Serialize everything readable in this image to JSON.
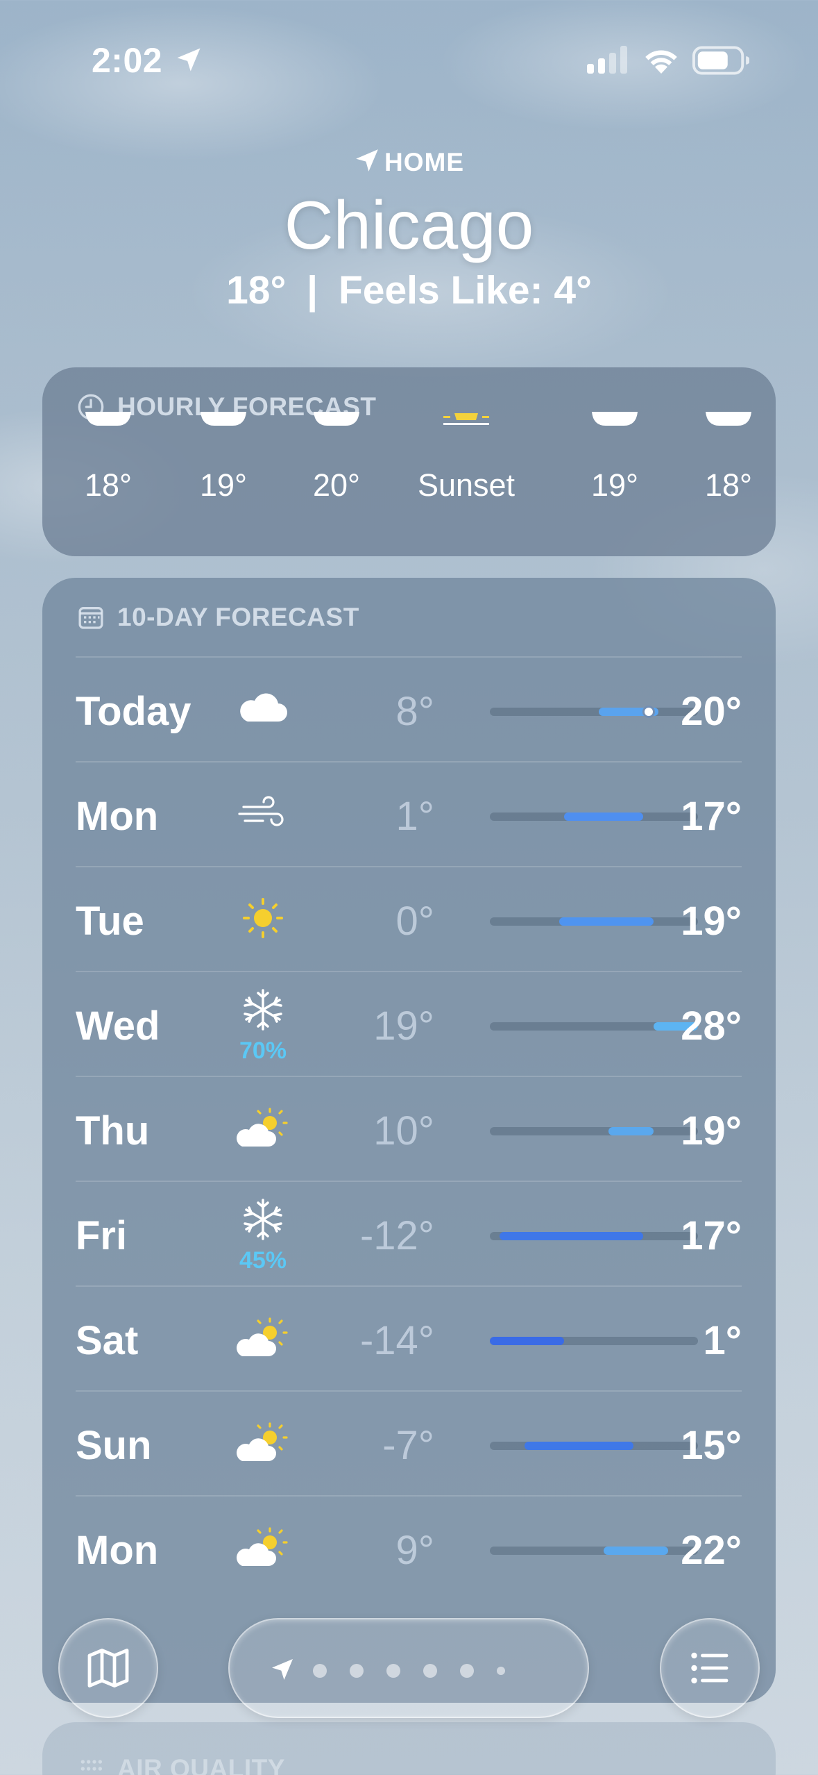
{
  "status_bar": {
    "time": "2:02"
  },
  "header": {
    "location_label": "HOME",
    "city": "Chicago",
    "current_temp": "18°",
    "separator": "|",
    "feels_like": "Feels Like: 4°"
  },
  "hourly": {
    "title": "HOURLY FORECAST",
    "items": [
      {
        "temp": "18°",
        "icon": "cloud-icon"
      },
      {
        "temp": "19°",
        "icon": "cloud-icon"
      },
      {
        "temp": "20°",
        "icon": "cloud-icon"
      },
      {
        "temp": "Sunset",
        "icon": "sunset-icon"
      },
      {
        "temp": "19°",
        "icon": "cloud-icon"
      },
      {
        "temp": "18°",
        "icon": "cloud-icon"
      }
    ]
  },
  "daily": {
    "title": "10-DAY FORECAST",
    "range_min": -14,
    "range_max": 28,
    "days": [
      {
        "name": "Today",
        "icon": "cloud-icon",
        "precip": "",
        "low": "8°",
        "high": "20°",
        "low_val": 8,
        "high_val": 20,
        "current_val": 18,
        "color": "#5aa3ee"
      },
      {
        "name": "Mon",
        "icon": "wind-icon",
        "precip": "",
        "low": "1°",
        "high": "17°",
        "low_val": 1,
        "high_val": 17,
        "color": "#4f8ff0"
      },
      {
        "name": "Tue",
        "icon": "sun-icon",
        "precip": "",
        "low": "0°",
        "high": "19°",
        "low_val": 0,
        "high_val": 19,
        "color": "#4f94f0"
      },
      {
        "name": "Wed",
        "icon": "snowflake-icon",
        "precip": "70%",
        "low": "19°",
        "high": "28°",
        "low_val": 19,
        "high_val": 28,
        "color": "#5db4f2"
      },
      {
        "name": "Thu",
        "icon": "partly-sunny-icon",
        "precip": "",
        "low": "10°",
        "high": "19°",
        "low_val": 10,
        "high_val": 19,
        "color": "#5aa8ee"
      },
      {
        "name": "Fri",
        "icon": "snowflake-icon",
        "precip": "45%",
        "low": "-12°",
        "high": "17°",
        "low_val": -12,
        "high_val": 17,
        "color": "#3f77e8"
      },
      {
        "name": "Sat",
        "icon": "partly-sunny-icon",
        "precip": "",
        "low": "-14°",
        "high": "1°",
        "low_val": -14,
        "high_val": 1,
        "color": "#3a6be6"
      },
      {
        "name": "Sun",
        "icon": "partly-sunny-icon",
        "precip": "",
        "low": "-7°",
        "high": "15°",
        "low_val": -7,
        "high_val": 15,
        "color": "#3f78e8"
      },
      {
        "name": "Mon",
        "icon": "partly-sunny-icon",
        "precip": "",
        "low": "9°",
        "high": "22°",
        "low_val": 9,
        "high_val": 22,
        "color": "#5aa8ee"
      }
    ]
  },
  "air_quality": {
    "title": "AIR QUALITY"
  },
  "toolbar": {
    "map_icon": "map-icon",
    "list_icon": "list-icon",
    "page_count": 7,
    "current_page": 0
  }
}
